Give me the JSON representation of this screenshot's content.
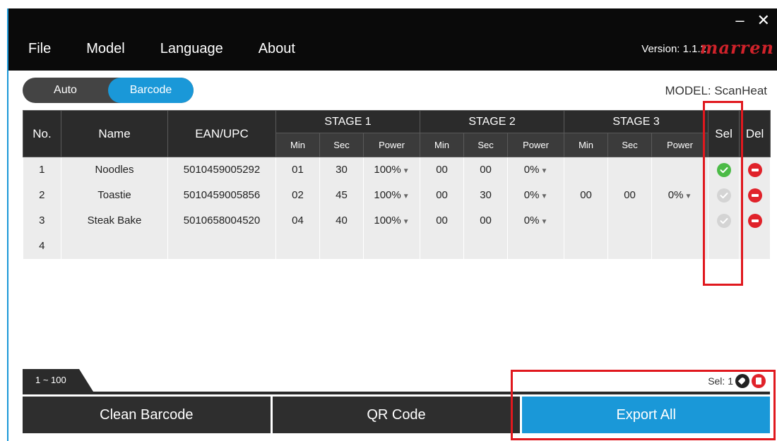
{
  "window": {
    "minimize": "–",
    "close": "✕"
  },
  "menu": [
    "File",
    "Model",
    "Language",
    "About"
  ],
  "version": "Version: 1.1.2",
  "brand": "marren",
  "mode_toggle": {
    "options": [
      "Auto",
      "Barcode"
    ],
    "selected": "Barcode"
  },
  "model_label": "MODEL: ScanHeat",
  "table": {
    "headers": {
      "no": "No.",
      "name": "Name",
      "ean": "EAN/UPC",
      "stage1": "STAGE 1",
      "stage2": "STAGE 2",
      "stage3": "STAGE 3",
      "sel": "Sel",
      "del": "Del",
      "min": "Min",
      "sec": "Sec",
      "power": "Power"
    },
    "rows": [
      {
        "no": "1",
        "name": "Noodles",
        "ean": "5010459005292",
        "s1": {
          "min": "01",
          "sec": "30",
          "power": "100%"
        },
        "s2": {
          "min": "00",
          "sec": "00",
          "power": "0%"
        },
        "s3": {
          "min": "",
          "sec": "",
          "power": ""
        },
        "selected": true
      },
      {
        "no": "2",
        "name": "Toastie",
        "ean": "5010459005856",
        "s1": {
          "min": "02",
          "sec": "45",
          "power": "100%"
        },
        "s2": {
          "min": "00",
          "sec": "30",
          "power": "0%"
        },
        "s3": {
          "min": "00",
          "sec": "00",
          "power": "0%"
        },
        "selected": false
      },
      {
        "no": "3",
        "name": "Steak Bake",
        "ean": "5010658004520",
        "s1": {
          "min": "04",
          "sec": "40",
          "power": "100%"
        },
        "s2": {
          "min": "00",
          "sec": "00",
          "power": "0%"
        },
        "s3": {
          "min": "",
          "sec": "",
          "power": ""
        },
        "selected": false
      },
      {
        "no": "4",
        "name": "",
        "ean": "",
        "s1": {
          "min": "",
          "sec": "",
          "power": ""
        },
        "s2": {
          "min": "",
          "sec": "",
          "power": ""
        },
        "s3": {
          "min": "",
          "sec": "",
          "power": ""
        },
        "selected": null
      }
    ]
  },
  "page_tab": "1 ~ 100",
  "sel_count": "Sel:  1",
  "actions": {
    "clean": "Clean Barcode",
    "qr": "QR Code",
    "export": "Export All"
  },
  "colors": {
    "accent": "#1a98d8",
    "delete": "#e0222a",
    "selected": "#4cbb47",
    "highlight": "#e0181e"
  }
}
